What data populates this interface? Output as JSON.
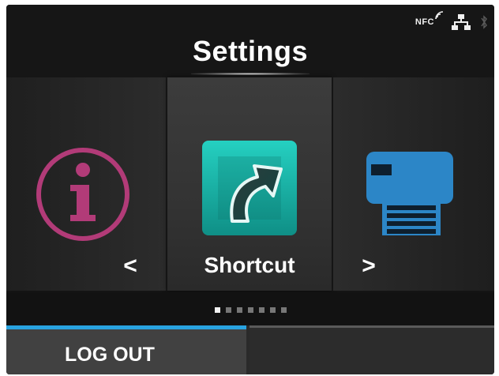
{
  "header": {
    "title": "Settings",
    "status": {
      "nfc_label": "NFC",
      "icons": [
        "nfc-icon",
        "network-icon",
        "bluetooth-icon"
      ]
    }
  },
  "carousel": {
    "items": [
      {
        "icon": "info-icon",
        "color": "#b23b78"
      },
      {
        "icon": "shortcut-icon",
        "label": "Shortcut",
        "color": "#17b3a8"
      },
      {
        "icon": "printer-icon",
        "color": "#2c86c7"
      }
    ],
    "prev_symbol": "<",
    "next_symbol": ">"
  },
  "pagination": {
    "count": 7,
    "active_index": 0
  },
  "bottom_bar": {
    "logout_label": "LOG OUT",
    "accent_color": "#29a3e0"
  }
}
